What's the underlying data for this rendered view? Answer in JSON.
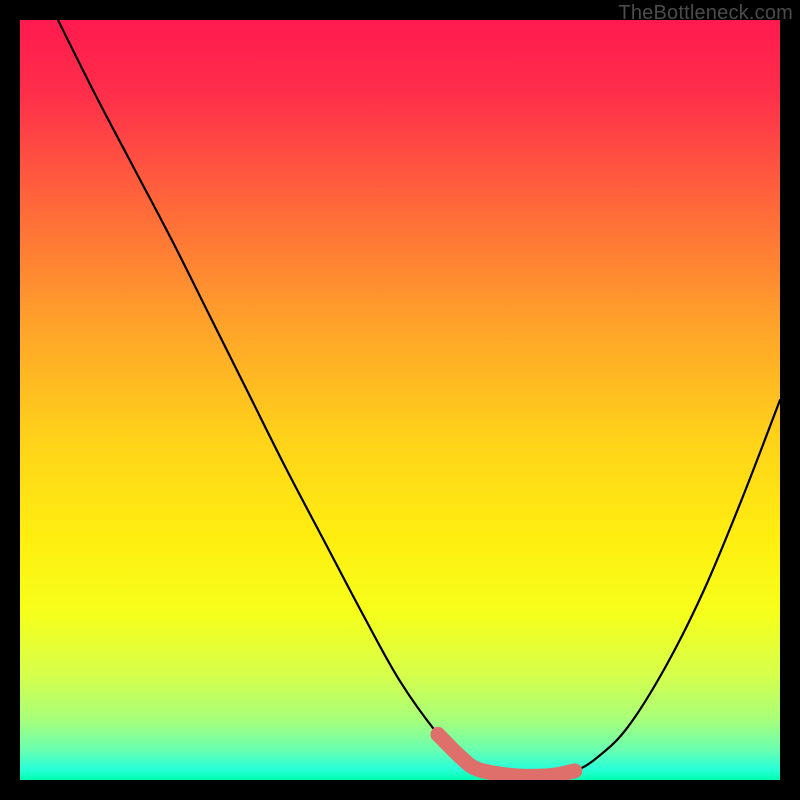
{
  "attribution": "TheBottleneck.com",
  "colors": {
    "bg": "#000000",
    "gradient_stops": [
      {
        "offset": 0.0,
        "color": "#ff1a4f"
      },
      {
        "offset": 0.1,
        "color": "#ff2f4a"
      },
      {
        "offset": 0.25,
        "color": "#ff6a3a"
      },
      {
        "offset": 0.4,
        "color": "#ffa22a"
      },
      {
        "offset": 0.55,
        "color": "#ffd21a"
      },
      {
        "offset": 0.68,
        "color": "#ffee10"
      },
      {
        "offset": 0.78,
        "color": "#f6ff1a"
      },
      {
        "offset": 0.86,
        "color": "#d7ff4a"
      },
      {
        "offset": 0.92,
        "color": "#a8ff7a"
      },
      {
        "offset": 0.96,
        "color": "#6affb0"
      },
      {
        "offset": 0.985,
        "color": "#2affd8"
      },
      {
        "offset": 1.0,
        "color": "#00ffb0"
      }
    ],
    "curve": "#000000",
    "highlight": "#df6f6a"
  },
  "chart_data": {
    "type": "line",
    "title": "",
    "xlabel": "",
    "ylabel": "",
    "xlim": [
      0,
      100
    ],
    "ylim": [
      0,
      100
    ],
    "grid": false,
    "series": [
      {
        "name": "bottleneck-curve",
        "x": [
          5,
          10,
          15,
          20,
          25,
          30,
          35,
          40,
          45,
          50,
          55,
          58,
          60,
          63,
          66,
          70,
          73,
          76,
          80,
          85,
          90,
          95,
          100
        ],
        "y": [
          100,
          90,
          80.5,
          71,
          61,
          51,
          41,
          31.5,
          22,
          13,
          6,
          3,
          1.5,
          0.8,
          0.5,
          0.6,
          1.2,
          3,
          7,
          15,
          25,
          37,
          50
        ]
      }
    ],
    "annotations": [
      {
        "name": "optimal-band",
        "style": "thick-highlight",
        "x": [
          55,
          58,
          60,
          63,
          66,
          70,
          73
        ],
        "y": [
          6,
          3,
          1.5,
          0.8,
          0.5,
          0.6,
          1.2
        ]
      }
    ]
  }
}
